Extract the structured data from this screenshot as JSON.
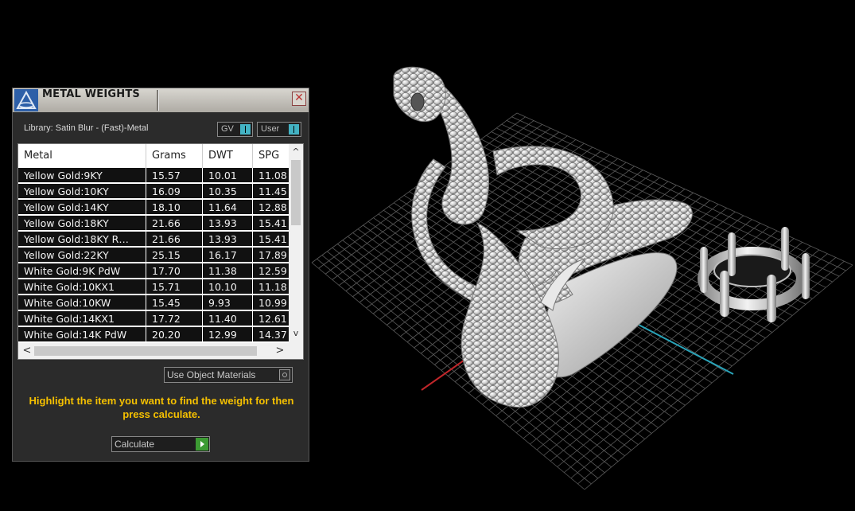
{
  "panel": {
    "title": "METAL WEIGHTS",
    "close_glyph": "✕",
    "library_label": "Library: Satin Blur - (Fast)-Metal",
    "toggles": {
      "gv": "GV",
      "user": "User"
    },
    "table": {
      "columns": [
        "Metal",
        "Grams",
        "DWT",
        "SPG"
      ],
      "rows": [
        [
          "Yellow Gold:9KY",
          "15.57",
          "10.01",
          "11.08"
        ],
        [
          "Yellow Gold:10KY",
          "16.09",
          "10.35",
          "11.45"
        ],
        [
          "Yellow Gold:14KY",
          "18.10",
          "11.64",
          "12.88"
        ],
        [
          "Yellow Gold:18KY",
          "21.66",
          "13.93",
          "15.41"
        ],
        [
          "Yellow Gold:18KY R…",
          "21.66",
          "13.93",
          "15.41"
        ],
        [
          "Yellow Gold:22KY",
          "25.15",
          "16.17",
          "17.89"
        ],
        [
          "White Gold:9K PdW",
          "17.70",
          "11.38",
          "12.59"
        ],
        [
          "White Gold:10KX1",
          "15.71",
          "10.10",
          "11.18"
        ],
        [
          "White Gold:10KW",
          "15.45",
          "9.93",
          "10.99"
        ],
        [
          "White Gold:14KX1",
          "17.72",
          "11.40",
          "12.61"
        ],
        [
          "White Gold:14K PdW",
          "20.20",
          "12.99",
          "14.37"
        ]
      ],
      "scroll_up": "^",
      "scroll_down": "v",
      "scroll_left": "<",
      "scroll_right": ">"
    },
    "use_object_materials": "Use Object Materials",
    "hint": "Highlight the item you want to find the weight for then press calculate.",
    "calculate_label": "Calculate",
    "icons": {
      "title": "metal-weights-app-icon",
      "close": "close-icon",
      "calculate": "play-arrow-icon"
    }
  },
  "viewport": {
    "icons": {
      "ring": "snake-ring-model",
      "setting": "prong-setting-model"
    },
    "colors": {
      "background": "#000000",
      "grid": "#5a5a5a",
      "axis_x": "#c0262a",
      "axis_y": "#2aa3b8",
      "model": "#d9d9d9"
    }
  }
}
